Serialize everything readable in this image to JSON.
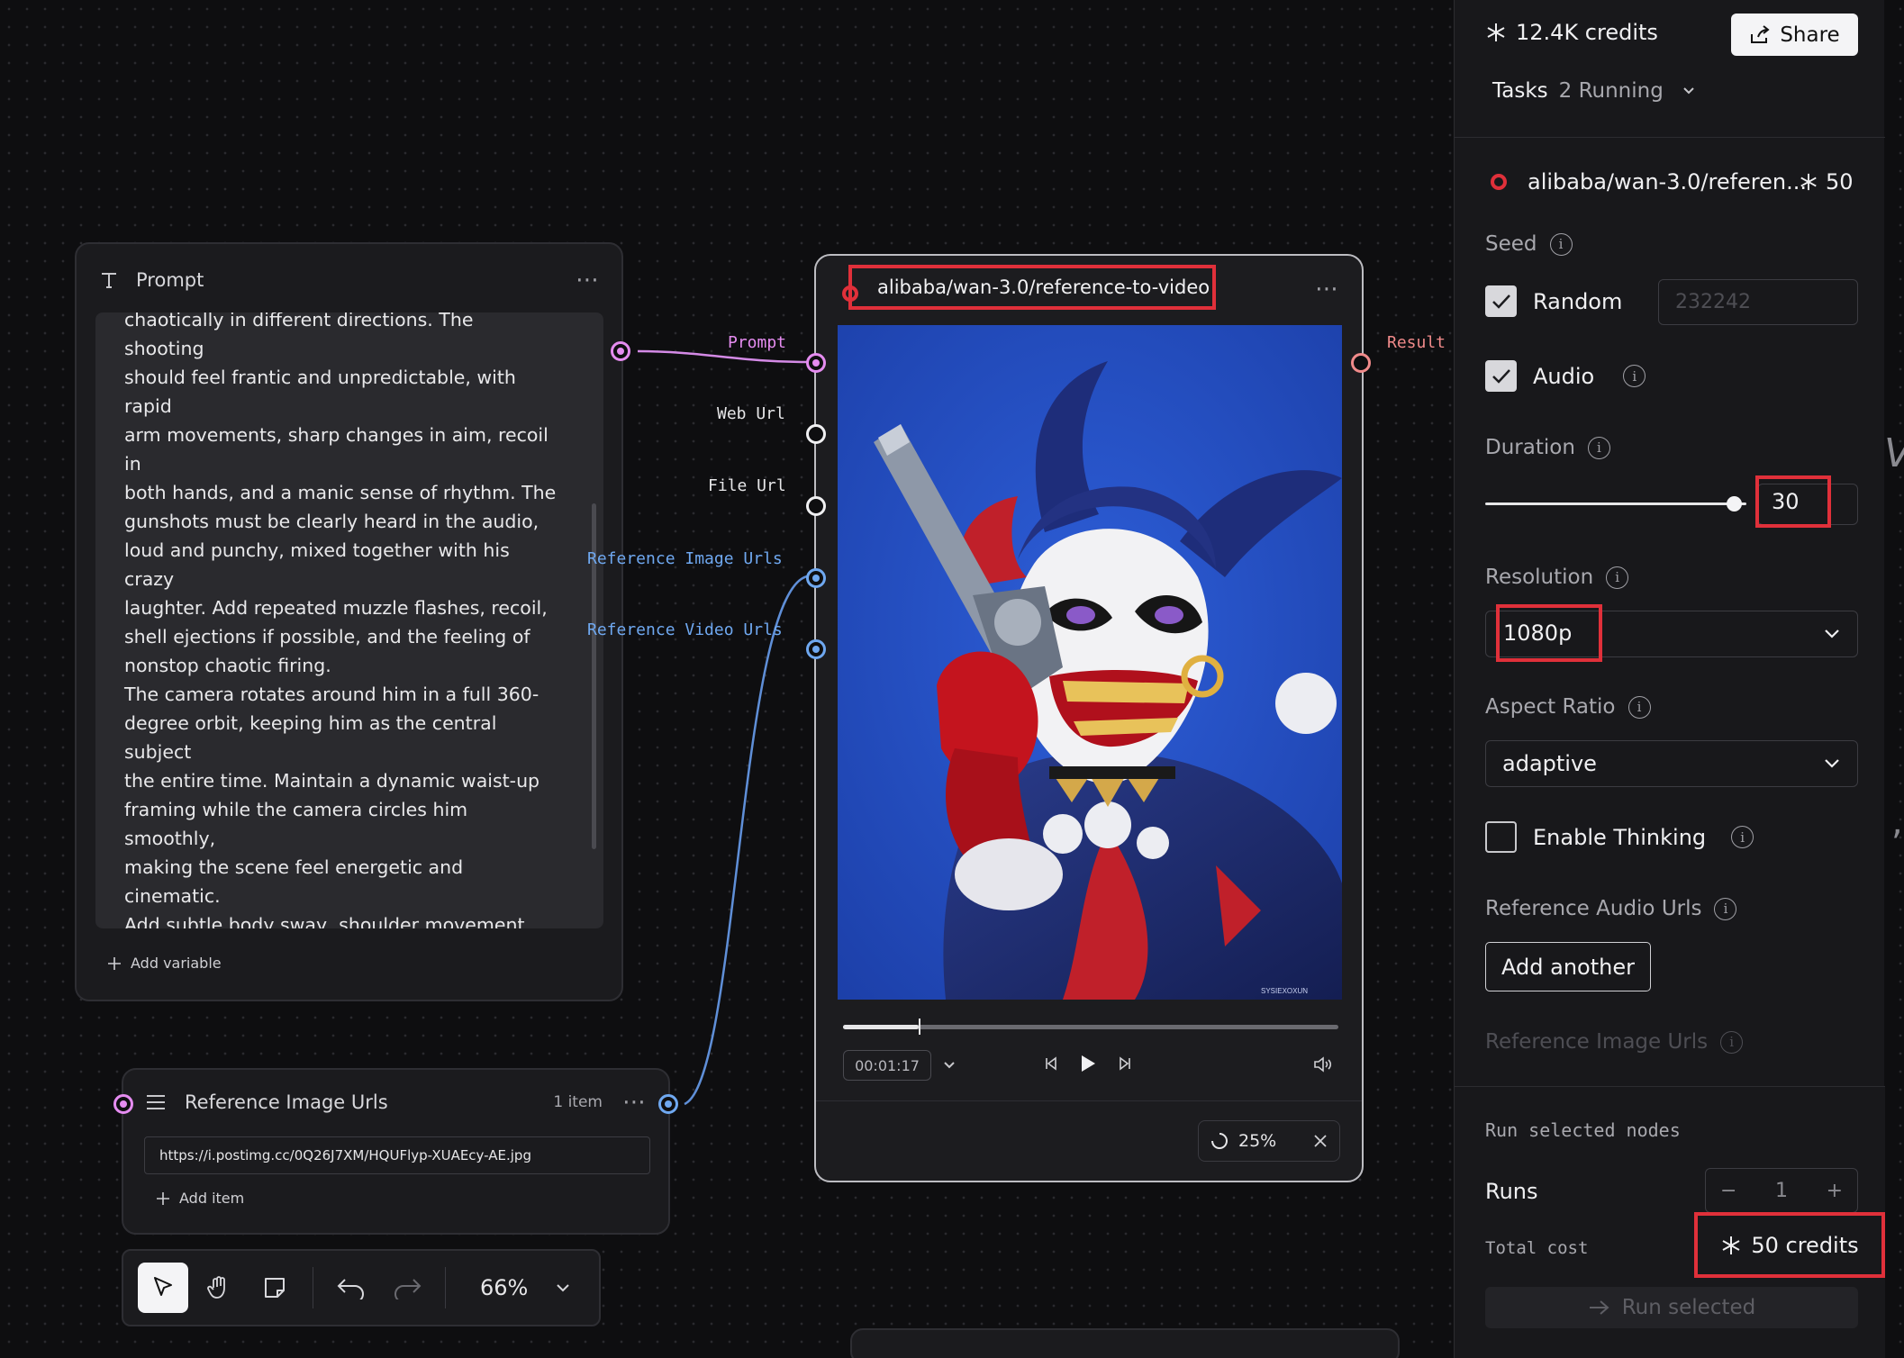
{
  "prompt_node": {
    "title": "Prompt",
    "text": "chaotically in different directions. The shooting\nshould feel frantic and unpredictable, with rapid\narm movements, sharp changes in aim, recoil in\nboth hands, and a manic sense of rhythm. The\ngunshots must be clearly heard in the audio,\nloud and punchy, mixed together with his crazy\nlaughter. Add repeated muzzle flashes, recoil,\nshell ejections if possible, and the feeling of\nnonstop chaotic firing.\nThe camera rotates around him in a full 360-\ndegree orbit, keeping him as the central subject\nthe entire time. Maintain a dynamic waist-up\nframing while the camera circles him smoothly,\nmaking the scene feel energetic and cinematic.\nAdd subtle body sway, shoulder movement,\nhead motion, facial tension, and constant\nmicro-movements so he feels alive and\nunstable.\nEmphasize that he looks like a glossy, shiny,\nalmost plastic doll, with lacquered surfaces,\nstrong specular highlights, reflective materials,\nbold 3D volume, and rich saturated color.",
    "add_variable_label": "Add variable",
    "menu_icon": "more-horizontal-icon"
  },
  "ports": {
    "prompt": "Prompt",
    "web_url": "Web Url",
    "file_url": "File Url",
    "reference_image_urls": "Reference Image Urls",
    "reference_video_urls": "Reference Video Urls",
    "result": "Result"
  },
  "model_node": {
    "title": "alibaba/wan-3.0/reference-to-video",
    "timecode": "00:01:17",
    "playback_progress": 0.153,
    "progress_percent": "25%",
    "watermark": "SYSIEXOXUN"
  },
  "reference_node": {
    "title": "Reference Image Urls",
    "count": "1 item",
    "url": "https://i.postimg.cc/0Q26J7XM/HQUFlyp-XUAEcy-AE.jpg",
    "add_item_label": "Add item"
  },
  "toolbar": {
    "zoom": "66%"
  },
  "panel": {
    "credits": "12.4K credits",
    "share_label": "Share",
    "tasks_label": "Tasks",
    "tasks_running": "2 Running",
    "model_name": "alibaba/wan-3.0/referen...",
    "model_cost": "50",
    "seed_label": "Seed",
    "random_label": "Random",
    "seed_placeholder": "232242",
    "audio_label": "Audio",
    "duration_label": "Duration",
    "duration_value": "30",
    "duration_fraction": 0.95,
    "resolution_label": "Resolution",
    "resolution_value": "1080p",
    "aspect_label": "Aspect Ratio",
    "aspect_value": "adaptive",
    "thinking_label": "Enable Thinking",
    "ref_audio_label": "Reference Audio Urls",
    "add_another_label": "Add another",
    "ref_image_label": "Reference Image Urls",
    "run_selected_nodes": "Run selected nodes",
    "runs_label": "Runs",
    "runs_value": "1",
    "total_cost_label": "Total cost",
    "total_cost_value": "50 credits",
    "run_button_label": "Run selected"
  },
  "colors": {
    "accent_red": "#e0303a",
    "port_pink": "#e58cf0",
    "port_blue": "#6fa8f0",
    "result_red": "#f08a8a"
  }
}
